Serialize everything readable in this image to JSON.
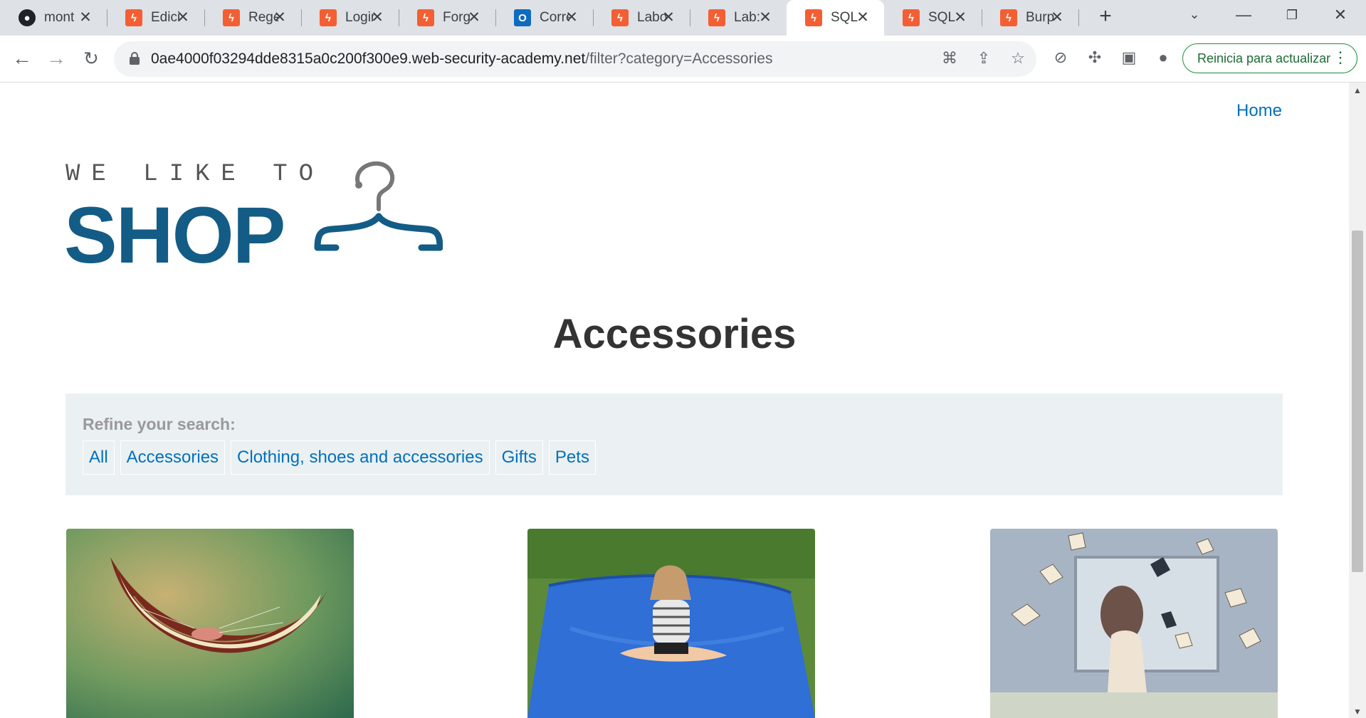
{
  "browser": {
    "tabs": [
      {
        "title": "mont",
        "favicon": "github-icon"
      },
      {
        "title": "Edici",
        "favicon": "burp-icon"
      },
      {
        "title": "Rege",
        "favicon": "burp-icon"
      },
      {
        "title": "Login",
        "favicon": "burp-icon"
      },
      {
        "title": "Forg",
        "favicon": "burp-icon"
      },
      {
        "title": "Corre",
        "favicon": "outlook-icon"
      },
      {
        "title": "Labo",
        "favicon": "burp-icon"
      },
      {
        "title": "Lab:",
        "favicon": "burp-icon"
      },
      {
        "title": "SQL",
        "favicon": "burp-icon",
        "active": true
      },
      {
        "title": "SQL",
        "favicon": "burp-icon"
      },
      {
        "title": "Burp",
        "favicon": "burp-icon"
      }
    ],
    "url_host": "0ae4000f03294dde8315a0c200f300e9.web-security-academy.net",
    "url_path": "/filter?category=Accessories",
    "update_button": "Reinicia para actualizar"
  },
  "page": {
    "home_link": "Home",
    "logo_top": "WE LIKE TO",
    "logo_main": "SHOP",
    "title": "Accessories",
    "filter": {
      "label": "Refine your search:",
      "categories": [
        "All",
        "Accessories",
        "Clothing, shoes and accessories",
        "Gifts",
        "Pets"
      ]
    }
  },
  "colors": {
    "brand": "#135c86",
    "link": "#0071bc",
    "filter_bg": "#ebf0f2",
    "update_green": "#1e8e3e"
  }
}
